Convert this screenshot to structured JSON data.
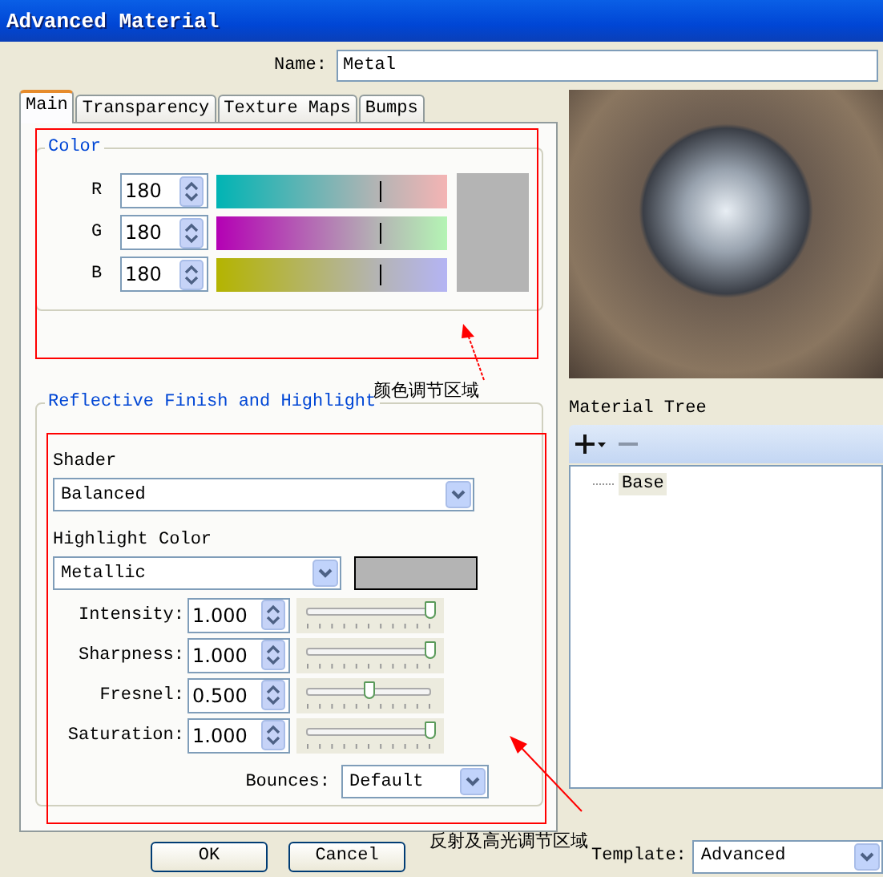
{
  "window": {
    "title": "Advanced Material"
  },
  "name_field": {
    "label": "Name:",
    "value": "Metal"
  },
  "tabs": [
    {
      "label": "Main",
      "selected": true
    },
    {
      "label": "Transparency",
      "selected": false
    },
    {
      "label": "Texture Maps",
      "selected": false
    },
    {
      "label": "Bumps",
      "selected": false
    }
  ],
  "color_group": {
    "title": "Color",
    "channels": [
      {
        "label": "R",
        "value": "180",
        "level": 0.706
      },
      {
        "label": "G",
        "value": "180",
        "level": 0.706
      },
      {
        "label": "B",
        "value": "180",
        "level": 0.706
      }
    ]
  },
  "reflective_group": {
    "title": "Reflective Finish and Highlight",
    "shader": {
      "label": "Shader",
      "value": "Balanced"
    },
    "highlight_color": {
      "label": "Highlight Color",
      "value": "Metallic"
    },
    "sliders": [
      {
        "label": "Intensity:",
        "value": "1.000",
        "level": 1.0
      },
      {
        "label": "Sharpness:",
        "value": "1.000",
        "level": 1.0
      },
      {
        "label": "Fresnel:",
        "value": "0.500",
        "level": 0.5
      },
      {
        "label": "Saturation:",
        "value": "1.000",
        "level": 1.0
      }
    ],
    "bounces": {
      "label": "Bounces:",
      "value": "Default"
    }
  },
  "material_tree": {
    "label": "Material Tree",
    "items": [
      {
        "label": "Base",
        "selected": true
      }
    ]
  },
  "buttons": [
    {
      "label": "OK"
    },
    {
      "label": "Cancel"
    }
  ],
  "template": {
    "label": "Template:",
    "value": "Advanced"
  },
  "annotations": [
    {
      "text": "颜色调节区域"
    },
    {
      "text": "反射及高光调节区域"
    }
  ]
}
